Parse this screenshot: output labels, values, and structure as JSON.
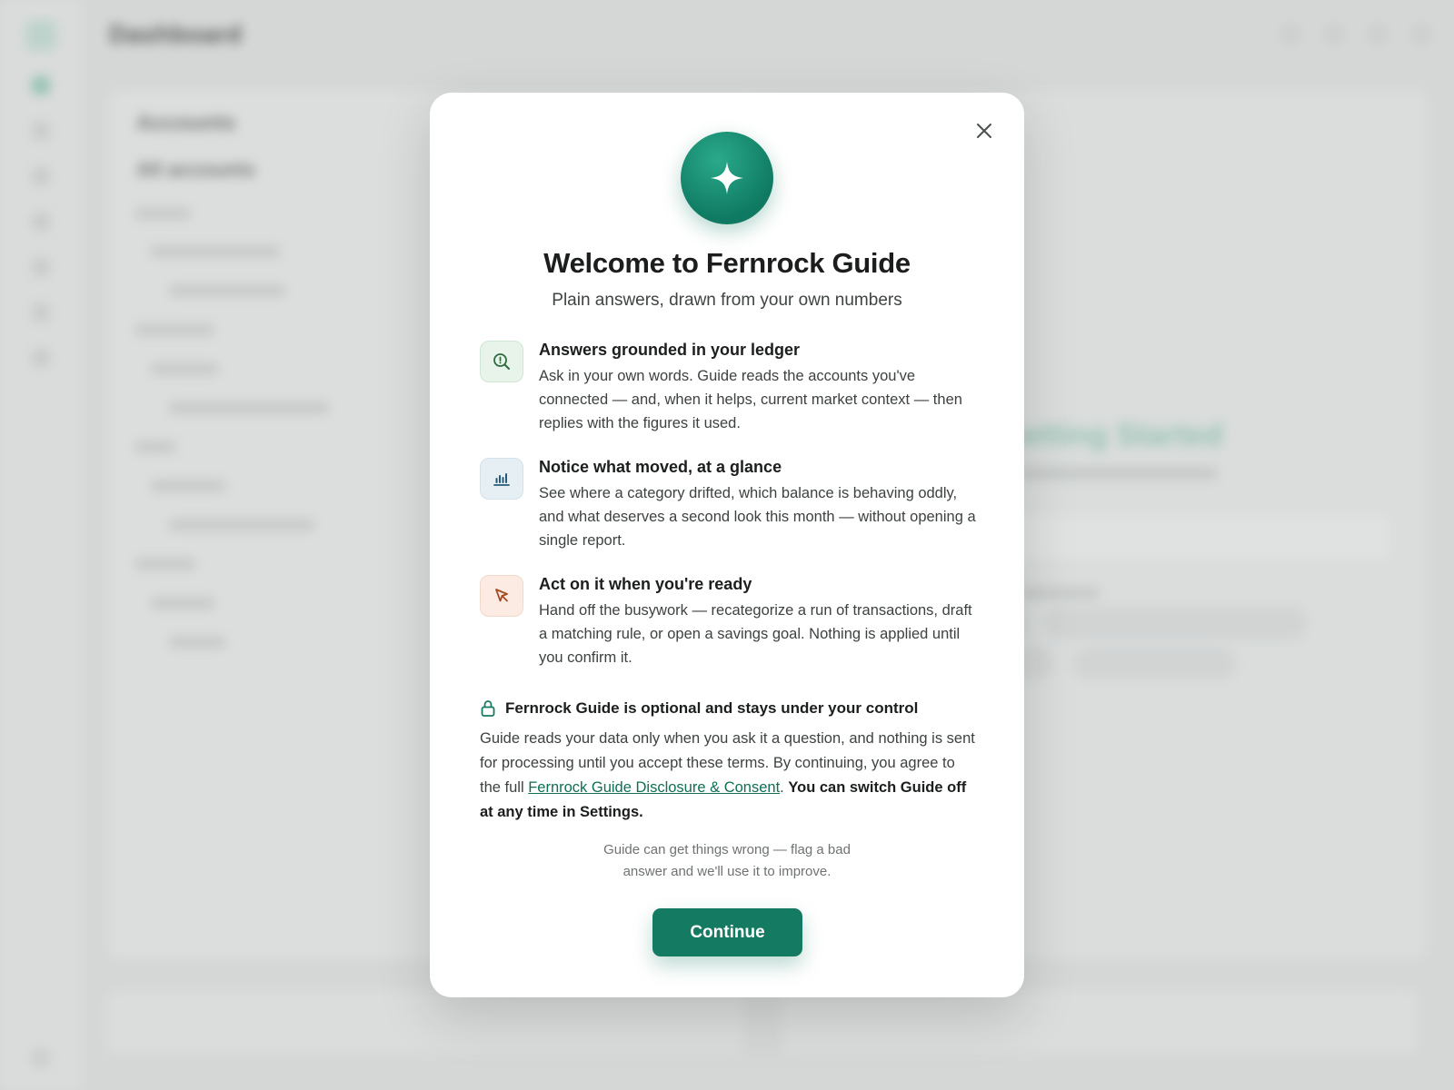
{
  "background": {
    "header": {
      "title": "Dashboard"
    },
    "panel": {
      "title": "Accounts",
      "subtitle": "All accounts"
    },
    "hero": {
      "title": "Getting Started"
    }
  },
  "modal": {
    "title": "Welcome to Fernrock Guide",
    "subtitle": "Plain answers, drawn from your own numbers",
    "features": [
      {
        "icon": "search-insight-icon",
        "title": "Answers grounded in your ledger",
        "description": "Ask in your own words. Guide reads the accounts you've connected — and, when it helps, current market context — then replies with the figures it used."
      },
      {
        "icon": "bar-chart-icon",
        "title": "Notice what moved, at a glance",
        "description": "See where a category drifted, which balance is behaving oddly, and what deserves a second look this month — without opening a single report."
      },
      {
        "icon": "cursor-arrow-icon",
        "title": "Act on it when you're ready",
        "description": "Hand off the busywork — recategorize a run of transactions, draft a matching rule, or open a savings goal. Nothing is applied until you confirm it."
      }
    ],
    "consent": {
      "icon": "lock-icon",
      "title": "Fernrock Guide is optional and stays under your control",
      "body_before_link": "Guide reads your data only when you ask it a question, and nothing is sent for processing until you accept these terms. By continuing, you agree to the full ",
      "link_text": "Fernrock Guide Disclosure & Consent",
      "body_after_link": ". ",
      "emphasis": "You can switch Guide off at any time in Settings."
    },
    "disclaimer": "Guide can get things wrong — flag a bad answer and we'll use it to improve.",
    "continue_label": "Continue",
    "close_label": "Close"
  },
  "colors": {
    "accent": "#157a62",
    "accent_light": "#2aa98a",
    "link": "#0f6e55"
  }
}
